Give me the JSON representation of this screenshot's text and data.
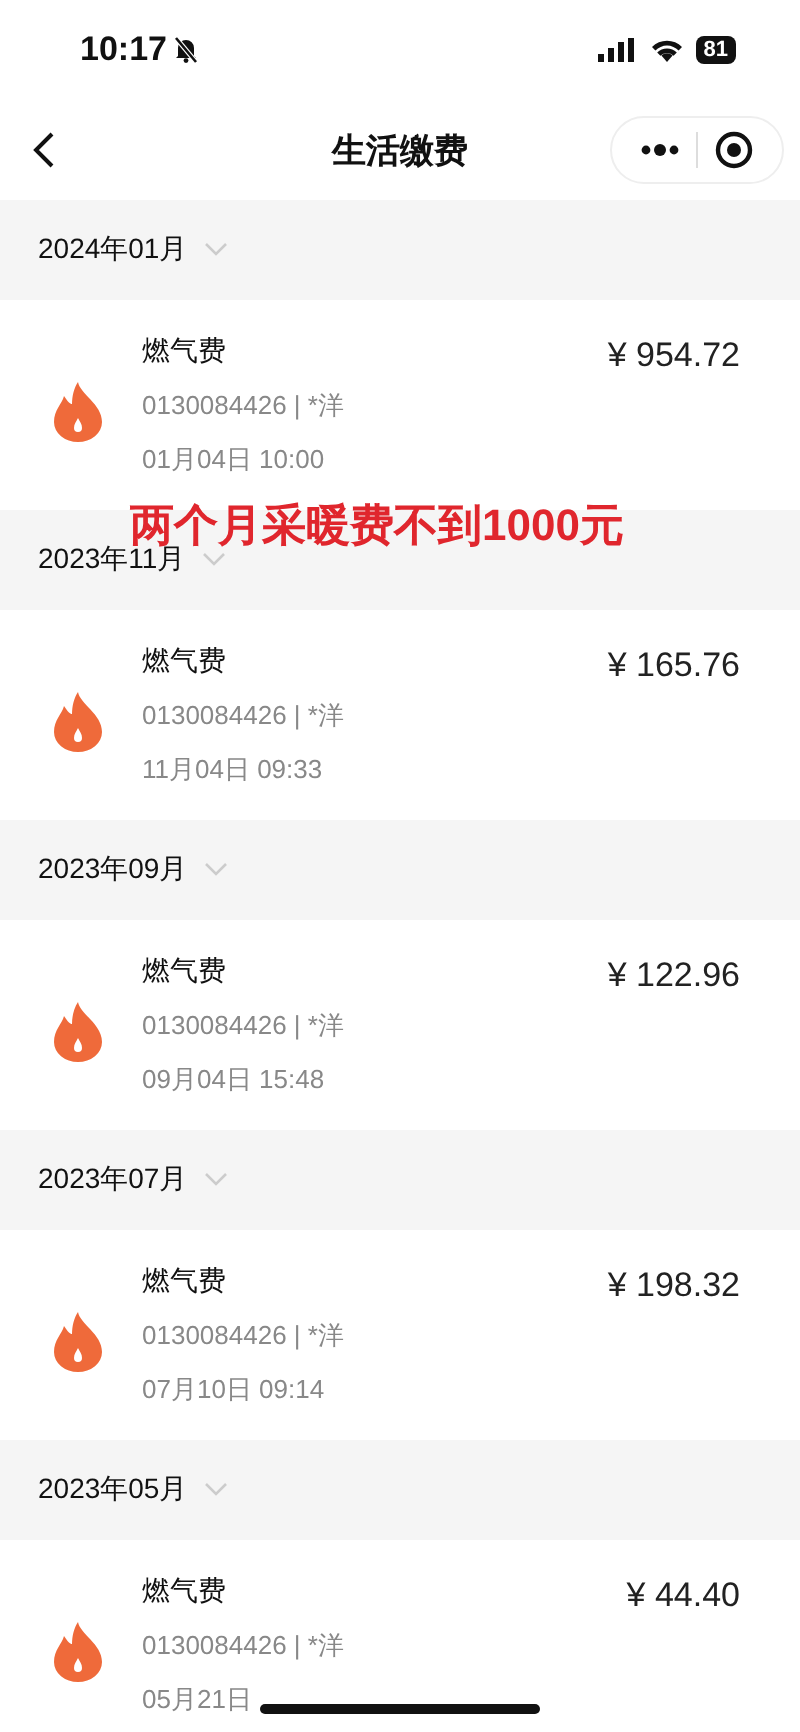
{
  "status_bar": {
    "time": "10:17",
    "battery": "81"
  },
  "nav_bar": {
    "title": "生活缴费"
  },
  "months": [
    {
      "month": "2024年01月",
      "bills": [
        {
          "name": "燃气费",
          "account": "0130084426 | *洋",
          "date": "01月04日 10:00",
          "amount": "¥ 954.72"
        }
      ]
    },
    {
      "month": "2023年11月",
      "bills": [
        {
          "name": "燃气费",
          "account": "0130084426 | *洋",
          "date": "11月04日 09:33",
          "amount": "¥ 165.76"
        }
      ]
    },
    {
      "month": "2023年09月",
      "bills": [
        {
          "name": "燃气费",
          "account": "0130084426 | *洋",
          "date": "09月04日 15:48",
          "amount": "¥ 122.96"
        }
      ]
    },
    {
      "month": "2023年07月",
      "bills": [
        {
          "name": "燃气费",
          "account": "0130084426 | *洋",
          "date": "07月10日 09:14",
          "amount": "¥ 198.32"
        }
      ]
    },
    {
      "month": "2023年05月",
      "bills": [
        {
          "name": "燃气费",
          "account": "0130084426 | *洋",
          "date": "05月21日",
          "amount": "¥ 44.40"
        }
      ]
    }
  ],
  "annotation": "两个月采暖费不到1000元"
}
